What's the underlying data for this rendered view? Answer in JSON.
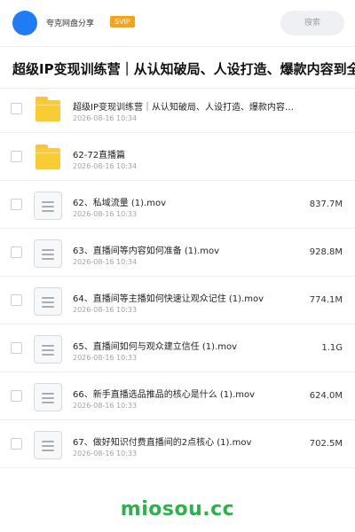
{
  "header": {
    "username": "夸克网盘分享",
    "badge": "SVIP",
    "search_label": "搜索"
  },
  "title": "超级IP变现训练营｜从认知破局、人设打造、爆款内容到全",
  "files": [
    {
      "name": "超级IP变现训练营｜从认知破局、人设打造、爆款内容…",
      "date": "2026-08-16 10:34",
      "size": "",
      "icon": "folder-icon"
    },
    {
      "name": "62-72直播篇",
      "date": "2026-08-16 10:34",
      "size": "",
      "icon": "folder-icon"
    },
    {
      "name": "62、私域流量 (1).mov",
      "date": "2026-08-16 10:33",
      "size": "837.7M",
      "icon": "video-file-icon"
    },
    {
      "name": "63、直播间等内容如何准备 (1).mov",
      "date": "2026-08-16 10:34",
      "size": "928.8M",
      "icon": "video-file-icon"
    },
    {
      "name": "64、直播间等主播如何快速让观众记住 (1).mov",
      "date": "2026-08-16 10:33",
      "size": "774.1M",
      "icon": "video-file-icon"
    },
    {
      "name": "65、直播间如何与观众建立信任 (1).mov",
      "date": "2026-08-16 10:33",
      "size": "1.1G",
      "icon": "video-file-icon"
    },
    {
      "name": "66、新手直播选品推品的核心是什么 (1).mov",
      "date": "2026-08-16 10:33",
      "size": "624.0M",
      "icon": "video-file-icon"
    },
    {
      "name": "67、做好知识付费直播间的2点核心 (1).mov",
      "date": "2026-08-16 10:33",
      "size": "702.5M",
      "icon": "video-file-icon"
    }
  ],
  "watermark": "miosou.cc",
  "colors": {
    "avatar": "#1f7cf5",
    "badge": "#f7a21a",
    "folder": "#f9cc34",
    "watermark": "#2cb24a"
  }
}
